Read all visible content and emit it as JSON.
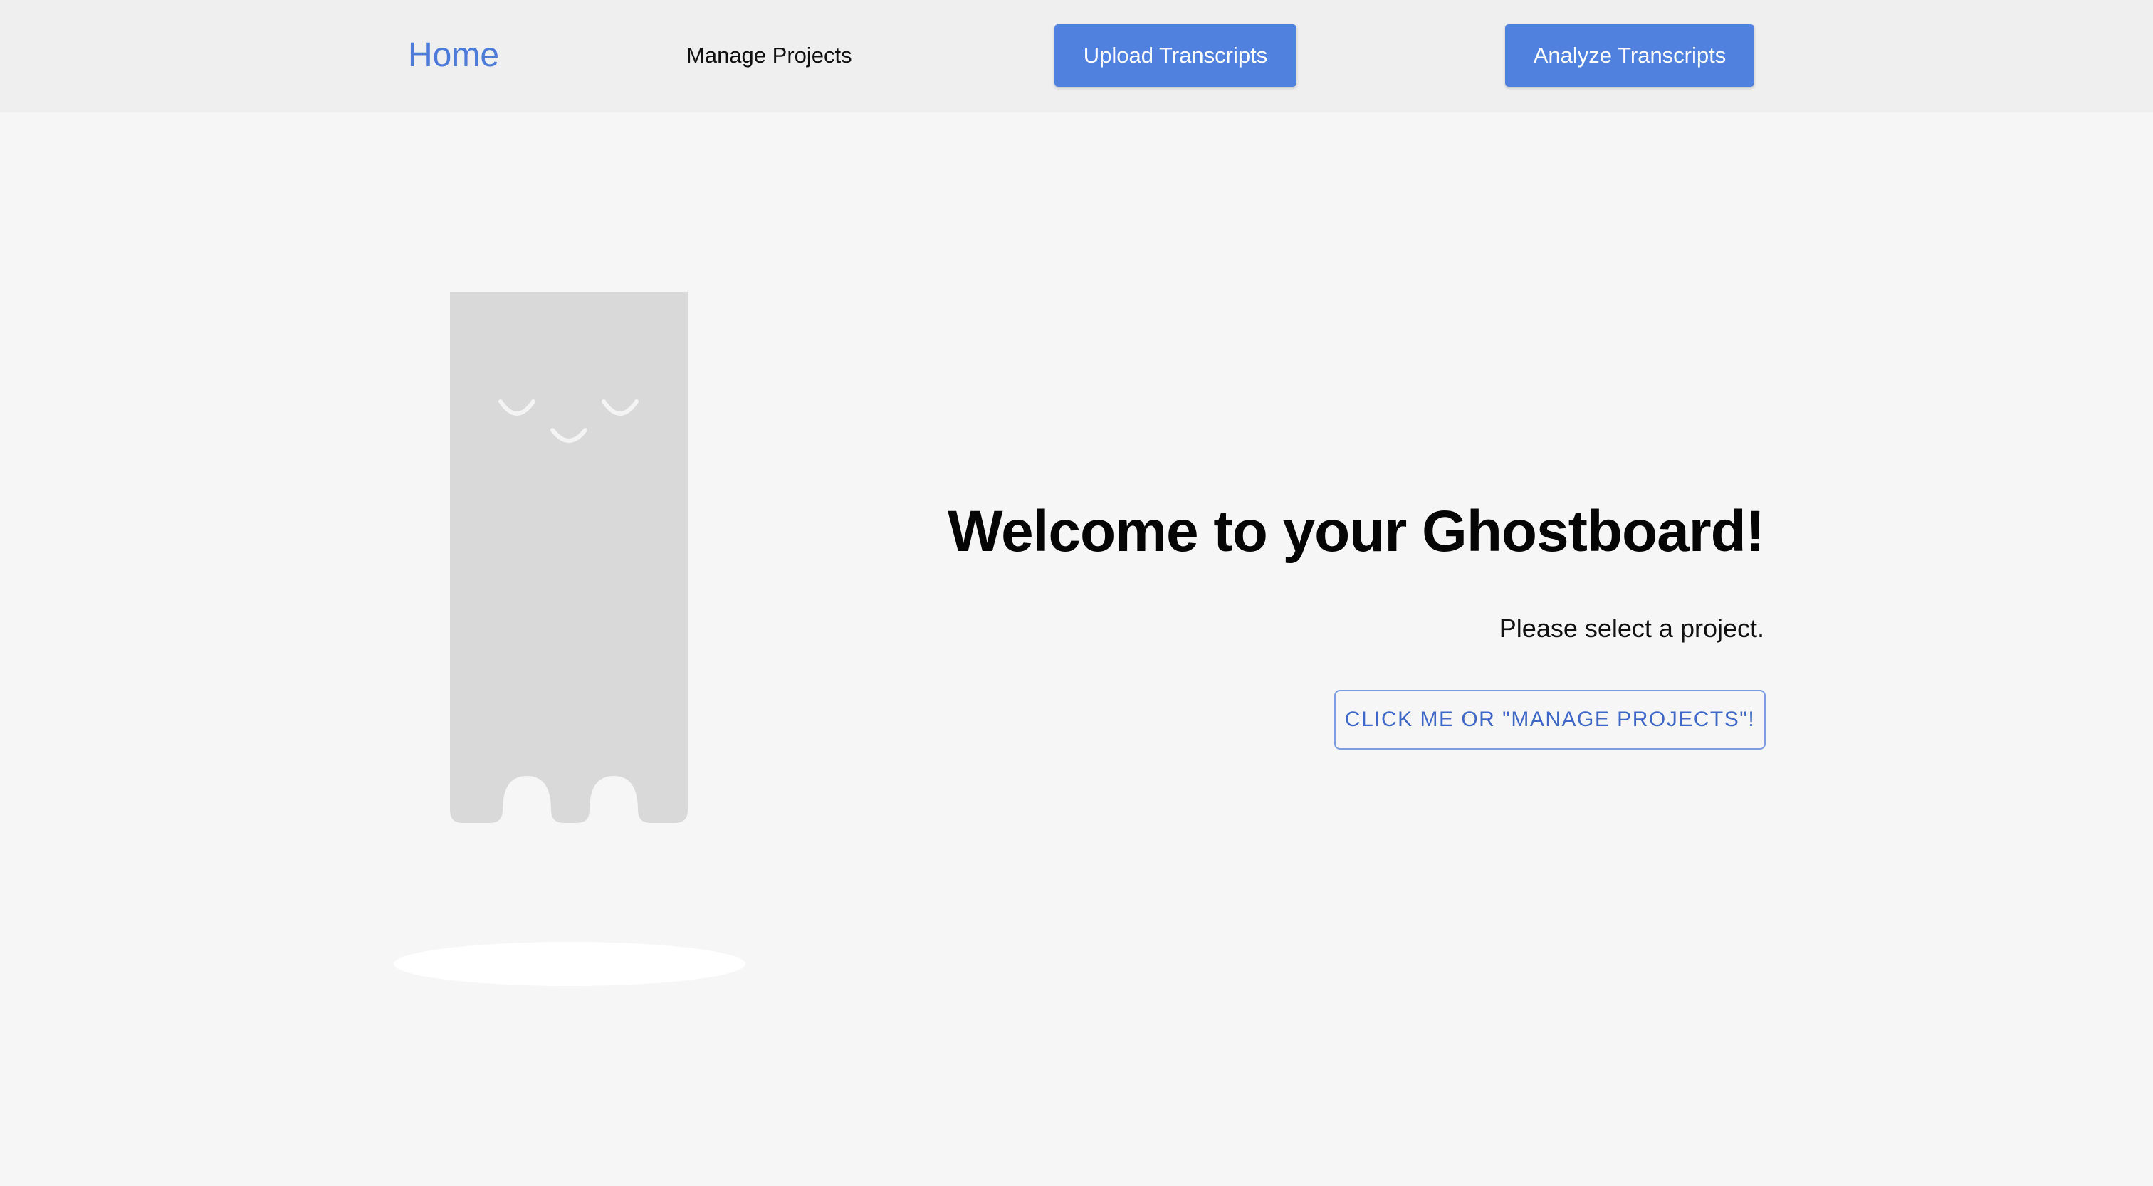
{
  "nav": {
    "home_label": "Home",
    "manage_label": "Manage Projects",
    "upload_label": "Upload Transcripts",
    "analyze_label": "Analyze Transcripts"
  },
  "main": {
    "title": "Welcome to your Ghostboard!",
    "subtitle": "Please select a project.",
    "cta_label": "CLICK ME OR \"MANAGE PROJECTS\"!"
  },
  "colors": {
    "accent": "#5181de",
    "link": "#4d7bd8",
    "navbar_bg": "#efefef",
    "page_bg": "#f6f6f6",
    "ghost_body": "#d9d9d9",
    "ghost_shadow": "#ffffff"
  },
  "icons": {
    "mascot": "ghost-illustration"
  }
}
